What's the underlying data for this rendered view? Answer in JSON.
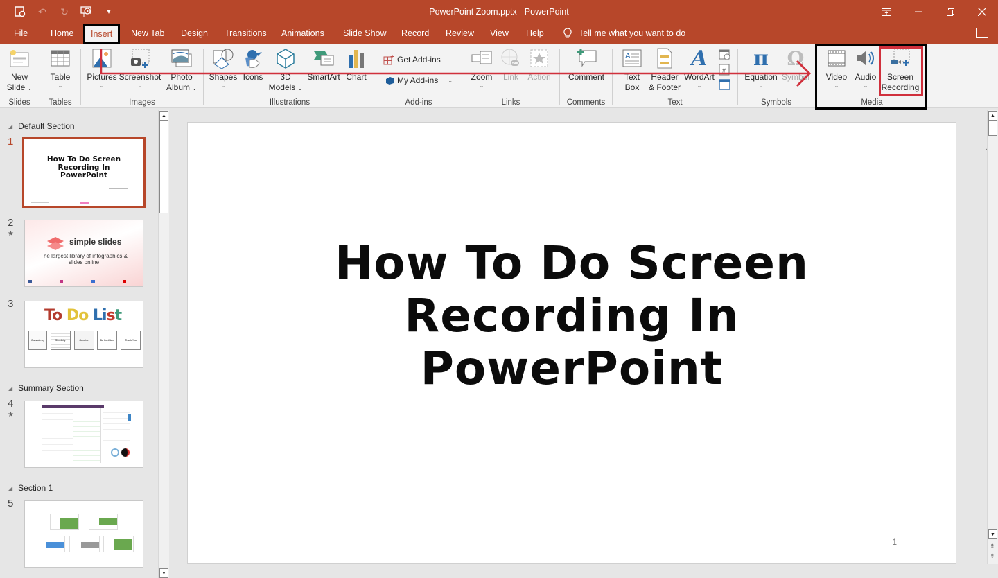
{
  "window": {
    "title": "PowerPoint Zoom.pptx  -  PowerPoint",
    "controls": [
      "ribbon-display-options",
      "minimize",
      "restore",
      "close"
    ]
  },
  "quick_access": {
    "items": [
      {
        "name": "autosave-icon",
        "glyph": "⟳"
      },
      {
        "name": "undo-icon",
        "glyph": "↶"
      },
      {
        "name": "redo-icon",
        "glyph": "↻"
      },
      {
        "name": "present-from-start-icon",
        "glyph": "▶"
      },
      {
        "name": "customize-qat-icon",
        "glyph": "▾"
      }
    ]
  },
  "tabs": [
    {
      "label": "File"
    },
    {
      "label": "Home"
    },
    {
      "label": "Insert",
      "active": true
    },
    {
      "label": "New Tab"
    },
    {
      "label": "Design"
    },
    {
      "label": "Transitions"
    },
    {
      "label": "Animations"
    },
    {
      "label": "Slide Show"
    },
    {
      "label": "Record"
    },
    {
      "label": "Review"
    },
    {
      "label": "View"
    },
    {
      "label": "Help"
    }
  ],
  "tell_me": "Tell me what you want to do",
  "ribbon": {
    "groups": {
      "slides": "Slides",
      "tables": "Tables",
      "images": "Images",
      "illustrations": "Illustrations",
      "addins": "Add-ins",
      "links": "Links",
      "comments": "Comments",
      "text": "Text",
      "symbols": "Symbols",
      "media": "Media"
    },
    "buttons": {
      "new_slide": [
        "New",
        "Slide"
      ],
      "table": "Table",
      "pictures": "Pictures",
      "screenshot": "Screenshot",
      "photo_album": [
        "Photo",
        "Album"
      ],
      "shapes": "Shapes",
      "icons": "Icons",
      "models_3d": [
        "3D",
        "Models"
      ],
      "smartart": "SmartArt",
      "chart": "Chart",
      "get_addins": "Get Add-ins",
      "my_addins": "My Add-ins",
      "zoom": "Zoom",
      "link": "Link",
      "action": "Action",
      "comment": "Comment",
      "text_box": [
        "Text",
        "Box"
      ],
      "header_footer": [
        "Header",
        "& Footer"
      ],
      "wordart": "WordArt",
      "equation": "Equation",
      "symbol": "Symbol",
      "video": "Video",
      "audio": "Audio",
      "screen_recording": [
        "Screen",
        "Recording"
      ]
    }
  },
  "slide_panel": {
    "sections": [
      {
        "label": "Default Section"
      },
      {
        "label": "Summary Section"
      },
      {
        "label": "Section 1"
      }
    ],
    "slides": [
      {
        "number": "1",
        "selected": true,
        "title": "How To Do Screen Recording In PowerPoint",
        "has_animation": false
      },
      {
        "number": "2",
        "selected": false,
        "brand": "simple slides",
        "subtitle": "The largest library of infographics & slides online",
        "has_animation": true
      },
      {
        "number": "3",
        "selected": false,
        "heading": "To Do List",
        "cards": [
          "Consistency",
          "Simplicity",
          "Genuine",
          "Be Confident",
          "Thank You"
        ],
        "has_animation": false
      },
      {
        "number": "4",
        "selected": false,
        "has_animation": true
      },
      {
        "number": "5",
        "selected": false,
        "has_animation": false
      }
    ],
    "star_glyph": "★"
  },
  "editor": {
    "slide_title": "How To Do Screen Recording In PowerPoint",
    "title_lines": [
      "How To Do Screen",
      "Recording In",
      "PowerPoint"
    ],
    "slide_number": "1"
  },
  "annotations": {
    "highlight_color": "#d0303c",
    "box_color": "#000000",
    "accent_color": "#b7472a"
  }
}
